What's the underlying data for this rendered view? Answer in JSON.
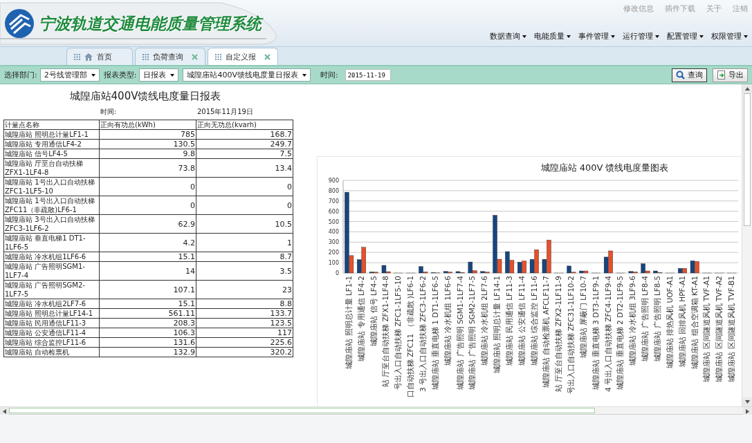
{
  "header": {
    "title": "宁波轨道交通电能质量管理系统",
    "top_links": [
      "修改信息",
      "插件下载",
      "关于",
      "注销"
    ],
    "menus": [
      "数据查询",
      "电能质量",
      "事件管理",
      "运行管理",
      "配置管理",
      "权限管理"
    ]
  },
  "tabs": [
    {
      "label": "首页",
      "kind": "home",
      "closable": false,
      "selected": false
    },
    {
      "label": "负荷查询",
      "kind": "page",
      "closable": true,
      "selected": false
    },
    {
      "label": "自定义报",
      "kind": "page",
      "closable": true,
      "selected": true
    }
  ],
  "filters": {
    "department_label": "选择部门:",
    "department": "2号线管理部",
    "report_type_label": "报表类型:",
    "report_type": "日报表",
    "report": "城隍庙站400V馈线电度量日报表",
    "time_label": "时间:",
    "time": "2015-11-19"
  },
  "actions": [
    {
      "label": "查询",
      "kind": "search"
    },
    {
      "label": "导出",
      "kind": "export"
    }
  ],
  "report": {
    "title": "城隍庙站400V馈线电度量日报表",
    "time_label": "时间:",
    "date": "2015年11月19日",
    "columns": [
      "计量点名称",
      "正向有功总(kWh)",
      "正向无功总(kvarh)"
    ],
    "rows": [
      [
        "城隍庙站 照明总计量LF1-1",
        "785",
        "168.7"
      ],
      [
        "城隍庙站 专用通信LF4-2",
        "130.5",
        "249.7"
      ],
      [
        "城隍庙站 信号LF4-5",
        "9.8",
        "7.5"
      ],
      [
        "城隍庙站 厅至台自动扶梯ZFX1-1LF4-8",
        "73.8",
        "13.4"
      ],
      [
        "城隍庙站 1号出入口自动扶梯ZFC1-1LF5-10",
        "0",
        "0"
      ],
      [
        "城隍庙站 1号出入口自动扶梯ZFC11（非疏散)LF6-1",
        "0",
        "0"
      ],
      [
        "城隍庙站 3号出入口自动扶梯ZFC3-1LF6-2",
        "62.9",
        "10.5"
      ],
      [
        "城隍庙站 垂直电梯1 DT1-1LF6-5",
        "4.2",
        "1"
      ],
      [
        "城隍庙站 冷水机组1LF6-6",
        "15.1",
        "8.7"
      ],
      [
        "城隍庙站 广告照明SGM1-1LF7-4",
        "14",
        "3.5"
      ],
      [
        "城隍庙站 广告照明SGM2-1LF7-5",
        "107.1",
        "23"
      ],
      [
        "城隍庙站 冷水机组2LF7-6",
        "15.1",
        "8.8"
      ],
      [
        "城隍庙站 照明总计量LF14-1",
        "561.11",
        "133.7"
      ],
      [
        "城隍庙站 民用通信LF11-3",
        "208.3",
        "123.5"
      ],
      [
        "城隍庙站 公安通信LF11-4",
        "106.3",
        "117"
      ],
      [
        "城隍庙站 综合监控LF11-6",
        "131.6",
        "225.6"
      ],
      [
        "城隍庙站 自动检票机",
        "132.9",
        "320.2"
      ]
    ]
  },
  "chart": {
    "chart_data": {
      "type": "bar",
      "title": "城隍庙站 400V 馈线电度量图表",
      "categories": [
        "城隍庙站 照明总计量 LF1-1",
        "城隍庙站 专用通信 LF4-2",
        "城隍庙站 信号 LF4-5",
        "站 厅至台自动扶梯 ZFX1-1LF4-8",
        "号出入口自动扶梯 ZFC1-1LF5-10",
        "口自动扶梯 ZFC11 （非疏散 )LF6-1",
        "3 号出入口自动扶梯 ZFC3-1LF6-2",
        "城隍庙站 垂直电梯 1 DT1-1LF6-5",
        "城隍庙站 冷水机组 1LF6-6",
        "城隍庙站 广告照明 SGM1-1LF7-4",
        "城隍庙站 广告照明 SGM2-1LF7-5",
        "城隍庙站 冷水机组 2LF7-6",
        "城隍庙站 照明总计量 LF14-1",
        "城隍庙站 民用通信 LF11-3",
        "城隍庙站 公安通信 LF11-4",
        "城隍庙站 综合监控 LF11-6",
        "城隍庙站 自动检票机 AFCLF11-7",
        "站 厅至台自动扶梯 ZFX2-1LF11-9",
        "号出入口自动扶梯 ZFC31-1LF10-2",
        "城隍庙站 屏蔽门 LF10-7",
        "城隍庙站 垂直电梯 3 DT3-1LF9-1",
        "4 号出入口自动扶梯 ZFC4-1LF9-4",
        "城隍庙站 垂直电梯 2 DT2-1LF9-5",
        "城隍庙站 冷水机组 3LF9-6",
        "城隍庙站 广告照明 LF8-4",
        "城隍庙站 广告照明 LF8-5",
        "城隍庙站 排热风机 UOF-A1",
        "城隍庙站 回排风机 HPF-A1",
        "城隍庙站 组合空调箱 KT-A1",
        "城隍庙站 区间隧道风机 TVF-A1",
        "城隍庙站 区间隧道风机 TVF-A2",
        "城隍庙站 区间隧道风机 TVF-B1"
      ],
      "series": [
        {
          "color": "#17457e",
          "values": [
            785,
            130,
            10,
            74,
            0,
            0,
            63,
            4,
            15,
            14,
            107,
            15,
            561,
            208,
            106,
            132,
            133,
            0,
            68,
            20,
            0,
            155,
            0,
            15,
            90,
            20,
            0,
            45,
            118,
            0,
            0,
            0
          ]
        },
        {
          "color": "#e8502a",
          "values": [
            169,
            250,
            8,
            13,
            0,
            0,
            11,
            1,
            9,
            4,
            23,
            9,
            134,
            124,
            117,
            226,
            320,
            0,
            8,
            20,
            0,
            215,
            0,
            10,
            20,
            5,
            0,
            45,
            112,
            0,
            0,
            0
          ]
        }
      ],
      "grid": true,
      "ylim": [
        0,
        900
      ],
      "yticks": [
        0,
        100,
        200,
        300,
        400,
        500,
        600,
        700,
        800,
        900
      ]
    }
  }
}
